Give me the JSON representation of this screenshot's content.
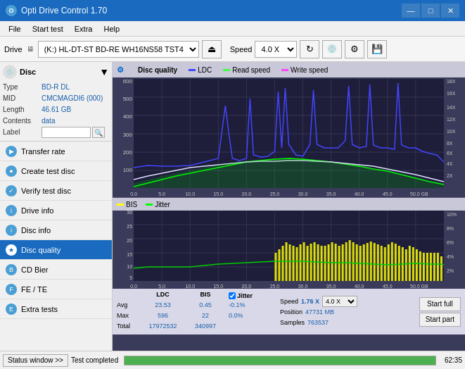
{
  "titleBar": {
    "title": "Opti Drive Control 1.70",
    "icon": "O",
    "minimize": "—",
    "maximize": "□",
    "close": "✕"
  },
  "menuBar": {
    "items": [
      "File",
      "Start test",
      "Extra",
      "Help"
    ]
  },
  "toolbar": {
    "driveLabel": "Drive",
    "driveValue": "(K:)  HL-DT-ST BD-RE  WH16NS58 TST4",
    "speedLabel": "Speed",
    "speedValue": "4.0 X"
  },
  "disc": {
    "title": "Disc",
    "type_label": "Type",
    "type_value": "BD-R DL",
    "mid_label": "MID",
    "mid_value": "CMCMAGDI6 (000)",
    "length_label": "Length",
    "length_value": "46.61 GB",
    "contents_label": "Contents",
    "contents_value": "data",
    "label_label": "Label"
  },
  "navItems": [
    {
      "id": "transfer-rate",
      "label": "Transfer rate",
      "icon": "▶",
      "active": false
    },
    {
      "id": "create-test-disc",
      "label": "Create test disc",
      "icon": "●",
      "active": false
    },
    {
      "id": "verify-test-disc",
      "label": "Verify test disc",
      "icon": "✓",
      "active": false
    },
    {
      "id": "drive-info",
      "label": "Drive info",
      "icon": "i",
      "active": false
    },
    {
      "id": "disc-info",
      "label": "Disc info",
      "icon": "i",
      "active": false
    },
    {
      "id": "disc-quality",
      "label": "Disc quality",
      "icon": "★",
      "active": true
    },
    {
      "id": "cd-bier",
      "label": "CD Bier",
      "icon": "B",
      "active": false
    },
    {
      "id": "fe-te",
      "label": "FE / TE",
      "icon": "F",
      "active": false
    },
    {
      "id": "extra-tests",
      "label": "Extra tests",
      "icon": "E",
      "active": false
    }
  ],
  "statusWindow": "Status window >>",
  "chartTitle": "Disc quality",
  "legend": {
    "ldc": "LDC",
    "readSpeed": "Read speed",
    "writeSpeed": "Write speed"
  },
  "legendLower": {
    "bis": "BIS",
    "jitter": "Jitter"
  },
  "upperAxis": {
    "left": [
      "600",
      "500",
      "400",
      "300",
      "200",
      "100"
    ],
    "right": [
      "18X",
      "16X",
      "14X",
      "12X",
      "10X",
      "8X",
      "6X",
      "4X",
      "2X"
    ],
    "bottom": [
      "0.0",
      "5.0",
      "10.0",
      "15.0",
      "20.0",
      "25.0",
      "30.0",
      "35.0",
      "40.0",
      "45.0",
      "50.0 GB"
    ]
  },
  "lowerAxis": {
    "left": [
      "30",
      "25",
      "20",
      "15",
      "10",
      "5"
    ],
    "right": [
      "10%",
      "8%",
      "6%",
      "4%",
      "2%"
    ],
    "bottom": [
      "0.0",
      "5.0",
      "10.0",
      "15.0",
      "20.0",
      "25.0",
      "30.0",
      "35.0",
      "40.0",
      "45.0",
      "50.0 GB"
    ]
  },
  "stats": {
    "columns": {
      "ldc": "LDC",
      "bis": "BIS",
      "jitter": "Jitter"
    },
    "rows": {
      "avg": {
        "label": "Avg",
        "ldc": "23.53",
        "bis": "0.45",
        "jitter": "-0.1%"
      },
      "max": {
        "label": "Max",
        "ldc": "596",
        "bis": "22",
        "jitter": "0.0%"
      },
      "total": {
        "label": "Total",
        "ldc": "17972532",
        "bis": "340997",
        "jitter": ""
      }
    },
    "speed": {
      "label": "Speed",
      "value": "1.76 X"
    },
    "speed2": {
      "value": "4.0 X"
    },
    "position": {
      "label": "Position",
      "value": "47731 MB"
    },
    "samples": {
      "label": "Samples",
      "value": "763537"
    }
  },
  "buttons": {
    "startFull": "Start full",
    "startPart": "Start part"
  },
  "statusBar": {
    "windowBtn": "Status window >>",
    "status": "Test completed",
    "progress": 100,
    "time": "62:35"
  }
}
